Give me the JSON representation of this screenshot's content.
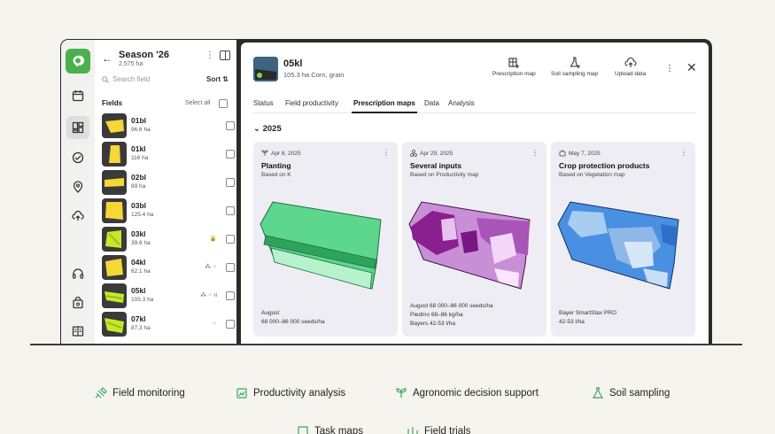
{
  "season": {
    "title": "Season '26",
    "area": "2,575 ha",
    "search_placeholder": "Search field",
    "sort_label": "Sort"
  },
  "fields_list": {
    "header": "Fields",
    "select_all": "Select all",
    "items": [
      {
        "name": "01bl",
        "area": "96.6 ha",
        "indicators": ""
      },
      {
        "name": "01kl",
        "area": "116 ha",
        "indicators": ""
      },
      {
        "name": "02bl",
        "area": "89 ha",
        "indicators": ""
      },
      {
        "name": "03bl",
        "area": "125.4 ha",
        "indicators": ""
      },
      {
        "name": "03kl",
        "area": "39.6 ha",
        "indicators": "🔒"
      },
      {
        "name": "04kl",
        "area": "62.1 ha",
        "indicators": "⁂ ⁘"
      },
      {
        "name": "05kl",
        "area": "105.3 ha",
        "indicators": "⁂ ⁘ ıl"
      },
      {
        "name": "07kl",
        "area": "87.3 ha",
        "indicators": "⁘"
      }
    ]
  },
  "field_detail": {
    "title": "05kl",
    "subtitle": "105.3 ha Corn, grain",
    "actions": {
      "prescription": "Prescription map",
      "soil": "Soil sampling map",
      "upload": "Upload data"
    },
    "tabs": [
      "Status",
      "Field productivity",
      "Prescription maps",
      "Data",
      "Analysis"
    ],
    "year": "2025"
  },
  "cards": [
    {
      "date": "Apr 8, 2025",
      "title": "Planting",
      "basis": "Based on K",
      "lines": [
        "August",
        "68 000–86 000 seeds/ha"
      ]
    },
    {
      "date": "Apr 29, 2025",
      "title": "Several inputs",
      "basis": "Based on Productivity map",
      "lines": [
        "August 68 000–86 000 seeds/ha",
        "Piedmo 68–86 kg/ha",
        "Bayers 42-53 l/ha"
      ]
    },
    {
      "date": "May 7, 2025",
      "title": "Crop protection products",
      "basis": "Based on Vegetation map",
      "lines": [
        "Bayer SmartStax PRO",
        "42-53 l/ha"
      ]
    }
  ],
  "features": [
    "Field monitoring",
    "Productivity analysis",
    "Agronomic decision support",
    "Soil sampling",
    "Task maps",
    "Field trials"
  ],
  "colors": {
    "brand_green": "#4caf50",
    "field_yellow": "#f5d735",
    "field_lime": "#c6ea2a",
    "planting_green": "#5dd68e",
    "inputs_purple": "#b36bc6",
    "protection_blue": "#4a90e2"
  }
}
